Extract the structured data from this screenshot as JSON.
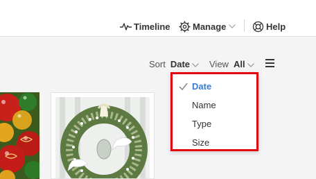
{
  "header": {
    "timeline_label": "Timeline",
    "timeline_icon": "pulse-icon",
    "manage_label": "Manage",
    "manage_icon": "gear-icon",
    "help_label": "Help",
    "help_icon": "lifebuoy-icon"
  },
  "toolbar": {
    "sort_label": "Sort",
    "sort_value": "Date",
    "view_label": "View",
    "view_value": "All",
    "menu_icon": "hamburger-icon"
  },
  "sort_menu": {
    "items": [
      {
        "label": "Date",
        "selected": true
      },
      {
        "label": "Name",
        "selected": false
      },
      {
        "label": "Type",
        "selected": false
      },
      {
        "label": "Size",
        "selected": false
      }
    ],
    "highlight_color": "#e3000f",
    "selected_color": "#3a7bd5"
  },
  "photos": [
    {
      "subject": "christmas-ornaments-photo"
    },
    {
      "subject": "christmas-wreath-with-doves-photo"
    }
  ]
}
